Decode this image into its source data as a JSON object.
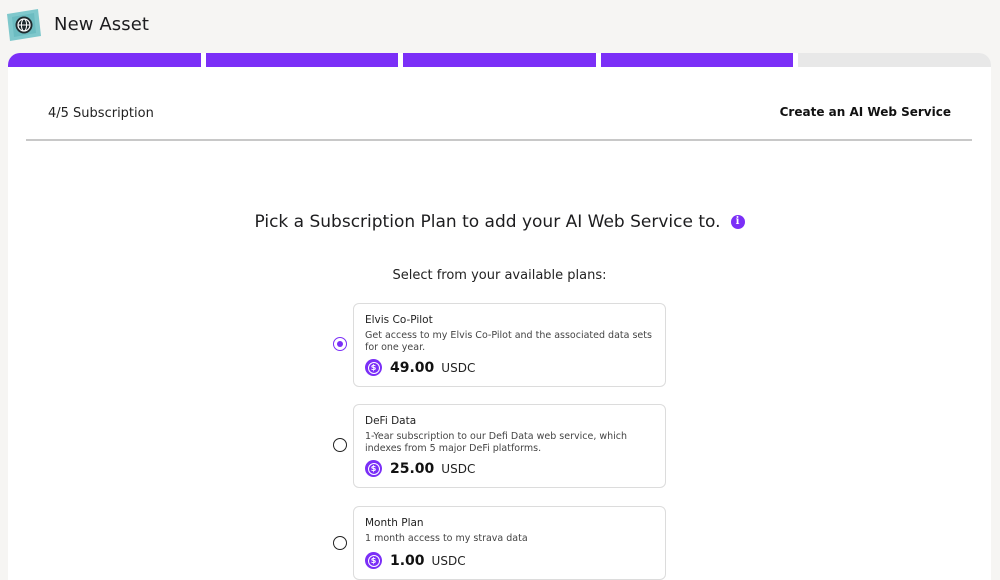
{
  "app": {
    "title": "New Asset"
  },
  "progress": {
    "total_steps": 5,
    "completed_steps": 4
  },
  "step": {
    "label": "4/5 Subscription"
  },
  "header": {
    "right_title": "Create an AI Web Service"
  },
  "main": {
    "heading": "Pick a Subscription Plan to add your AI Web Service to.",
    "info_glyph": "i",
    "subheading": "Select from your available plans:"
  },
  "plans": [
    {
      "name": "Elvis Co-Pilot",
      "description": "Get access to my Elvis Co-Pilot and the associated data sets for one year.",
      "price": "49.00",
      "currency": "USDC",
      "selected": true
    },
    {
      "name": "DeFi Data",
      "description": "1-Year subscription to our Defi Data web service, which indexes from 5 major DeFi platforms.",
      "price": "25.00",
      "currency": "USDC",
      "selected": false
    },
    {
      "name": "Month Plan",
      "description": "1 month access to my strava data",
      "price": "1.00",
      "currency": "USDC",
      "selected": false
    }
  ],
  "colors": {
    "accent": "#7b2ff7",
    "progress_empty": "#e8e8e8",
    "background": "#f6f5f3"
  },
  "icons": {
    "logo": "globe-card-logo-icon",
    "info": "info-icon",
    "currency": "usdc-coin-icon"
  }
}
